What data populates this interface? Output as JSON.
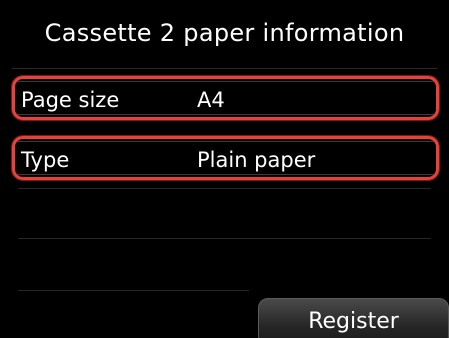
{
  "header": {
    "title": "Cassette 2 paper information"
  },
  "settings": {
    "rows": [
      {
        "label": "Page size",
        "value": "A4"
      },
      {
        "label": "Type",
        "value": "Plain paper"
      }
    ]
  },
  "footer": {
    "register_label": "Register"
  },
  "colors": {
    "background": "#000000",
    "highlight_border": "#e8413a",
    "text": "#ffffff"
  }
}
